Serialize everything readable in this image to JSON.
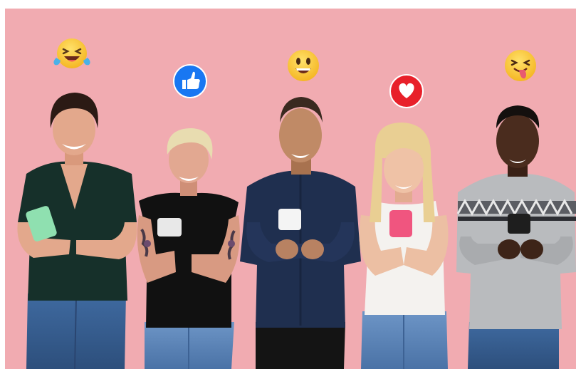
{
  "photo": {
    "background_color": "#f1abb1",
    "people_count": 5
  },
  "reactions": [
    {
      "icon": "laughing-tears-emoji-icon"
    },
    {
      "icon": "thumbs-up-like-icon"
    },
    {
      "icon": "grinning-emoji-icon"
    },
    {
      "icon": "red-heart-icon"
    },
    {
      "icon": "tongue-out-winking-emoji-icon"
    }
  ],
  "phones": [
    {
      "color": "#8fe0b0"
    },
    {
      "color": "#e8e8e8"
    },
    {
      "color": "#f4f4f4"
    },
    {
      "color": "#f0557f"
    },
    {
      "color": "#1e1e1e"
    }
  ],
  "colors": {
    "emoji_yellow": "#f8c62e",
    "like_blue": "#1877f2",
    "heart_red": "#e8202a"
  }
}
